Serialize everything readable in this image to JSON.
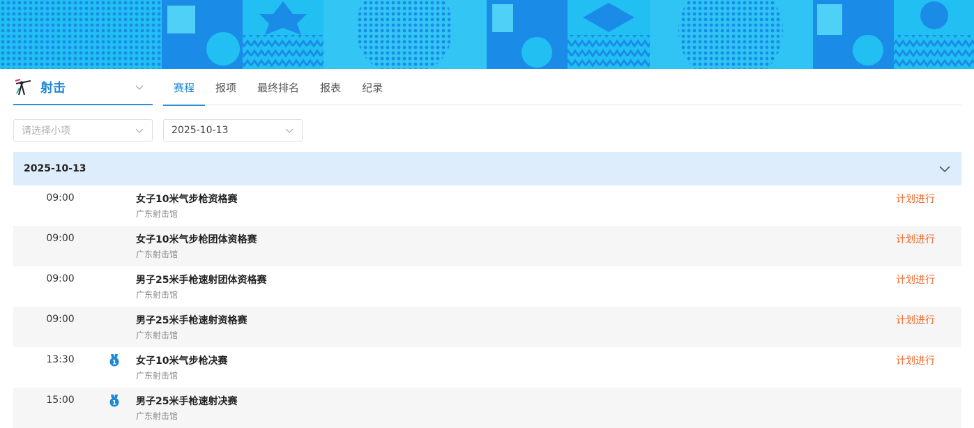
{
  "sport": {
    "name": "射击",
    "icon": "shooting-icon"
  },
  "tabs": [
    {
      "label": "赛程",
      "active": true
    },
    {
      "label": "报项",
      "active": false
    },
    {
      "label": "最终排名",
      "active": false
    },
    {
      "label": "报表",
      "active": false
    },
    {
      "label": "纪录",
      "active": false
    }
  ],
  "filters": {
    "event_placeholder": "请选择小项",
    "date_value": "2025-10-13"
  },
  "group": {
    "date": "2025-10-13"
  },
  "schedule": [
    {
      "time": "09:00",
      "medal": false,
      "event": "女子10米气步枪资格赛",
      "venue": "广东射击馆",
      "status": "计划进行"
    },
    {
      "time": "09:00",
      "medal": false,
      "event": "女子10米气步枪团体资格赛",
      "venue": "广东射击馆",
      "status": "计划进行"
    },
    {
      "time": "09:00",
      "medal": false,
      "event": "男子25米手枪速射团体资格赛",
      "venue": "广东射击馆",
      "status": "计划进行"
    },
    {
      "time": "09:00",
      "medal": false,
      "event": "男子25米手枪速射资格赛",
      "venue": "广东射击馆",
      "status": "计划进行"
    },
    {
      "time": "13:30",
      "medal": true,
      "event": "女子10米气步枪决赛",
      "venue": "广东射击馆",
      "status": "计划进行"
    },
    {
      "time": "15:00",
      "medal": true,
      "event": "男子25米手枪速射决赛",
      "venue": "广东射击馆",
      "status": ""
    }
  ],
  "colors": {
    "accent": "#1e88d2",
    "status": "#f26a2c",
    "group_header_bg": "#deedfb",
    "banner_light": "#1fb8f0",
    "banner_dark": "#1a8ce8"
  }
}
